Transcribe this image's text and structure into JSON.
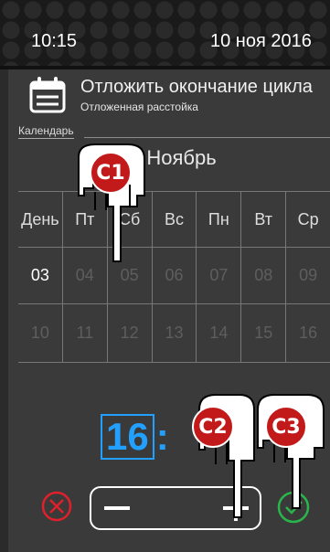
{
  "status": {
    "time": "10:15",
    "date": "10 ноя 2016"
  },
  "header": {
    "title": "Отложить окончание цикла",
    "subtitle": "Отложенная расстойка"
  },
  "calendar": {
    "label": "Календарь",
    "month": "Ноябрь",
    "weekday_header": [
      "День",
      "Пт",
      "Сб",
      "Вс",
      "Пн",
      "Вт",
      "Ср"
    ],
    "rows": [
      [
        "03",
        "04",
        "05",
        "06",
        "07",
        "08",
        "09"
      ],
      [
        "10",
        "11",
        "12",
        "13",
        "14",
        "15",
        "16"
      ]
    ],
    "selected_day": "03"
  },
  "time_input": {
    "hours": "16",
    "separator": ":"
  },
  "stepper": {
    "minus_icon": "minus-icon",
    "plus_icon": "plus-icon"
  },
  "actions": {
    "cancel_icon": "close-circle-icon",
    "confirm_icon": "check-circle-icon"
  },
  "callouts": [
    {
      "label": "C1"
    },
    {
      "label": "C2"
    },
    {
      "label": "C3"
    }
  ],
  "colors": {
    "accent_blue": "#22a0ff",
    "cancel_red": "#e0202a",
    "confirm_green": "#2ab44a",
    "callout_red": "#c21a1a"
  }
}
